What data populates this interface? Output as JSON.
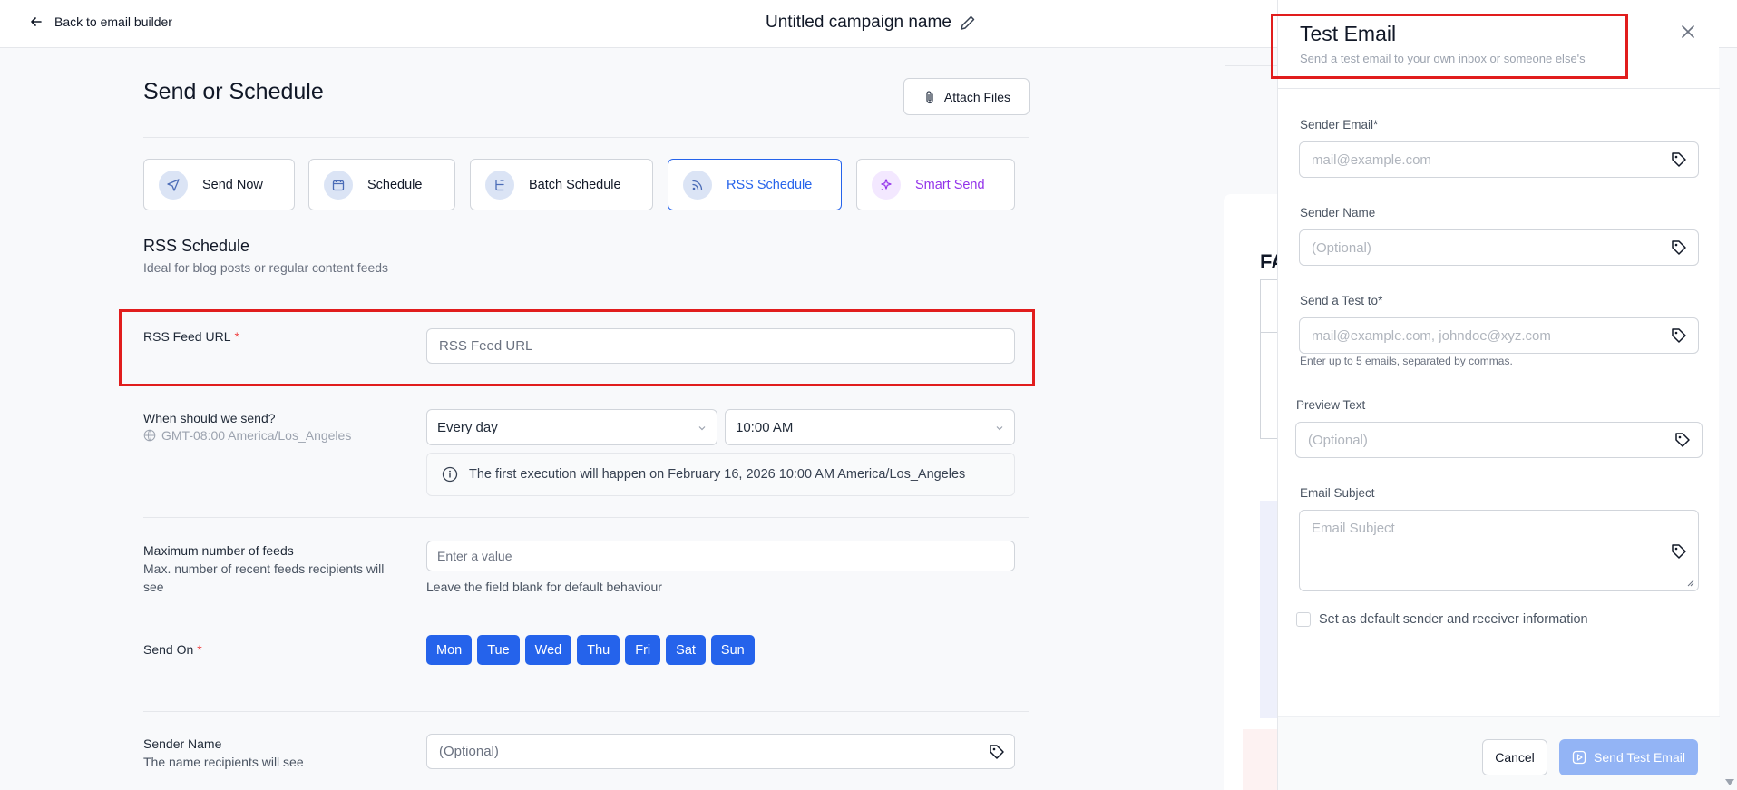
{
  "topbar": {
    "back_label": "Back to email builder",
    "campaign_name": "Untitled campaign name"
  },
  "main": {
    "title": "Send or Schedule",
    "attach_label": "Attach Files",
    "modes": [
      {
        "label": "Send Now",
        "icon": "send-icon"
      },
      {
        "label": "Schedule",
        "icon": "calendar-icon"
      },
      {
        "label": "Batch Schedule",
        "icon": "batch-icon"
      },
      {
        "label": "RSS Schedule",
        "icon": "rss-icon",
        "active": true
      },
      {
        "label": "Smart Send",
        "icon": "sparkle-icon"
      }
    ],
    "section_title": "RSS Schedule",
    "section_sub": "Ideal for blog posts or regular content feeds",
    "rss": {
      "label": "RSS Feed URL",
      "required": "*",
      "placeholder": "RSS Feed URL"
    },
    "when": {
      "label": "When should we send?",
      "timezone": "GMT-08:00 America/Los_Angeles",
      "frequency": "Every day",
      "time": "10:00 AM",
      "info": "The first execution will happen on February 16, 2026 10:00 AM America/Los_Angeles"
    },
    "max_feeds": {
      "label": "Maximum number of feeds",
      "sub": "Max. number of recent feeds recipients will see",
      "placeholder": "Enter a value",
      "hint": "Leave the field blank for default behaviour"
    },
    "send_on": {
      "label": "Send On",
      "required": "*",
      "days": [
        "Mon",
        "Tue",
        "Wed",
        "Thu",
        "Fri",
        "Sat",
        "Sun"
      ]
    },
    "sender_name": {
      "label": "Sender Name",
      "sub": "The name recipients will see",
      "placeholder": "(Optional)"
    }
  },
  "preview": {
    "heading_fragment": "FA"
  },
  "drawer": {
    "title": "Test Email",
    "subtitle": "Send a test email to your own inbox or someone else's",
    "fields": {
      "sender_email": {
        "label": "Sender Email*",
        "placeholder": "mail@example.com"
      },
      "sender_name": {
        "label": "Sender Name",
        "placeholder": "(Optional)"
      },
      "send_to": {
        "label": "Send a Test to*",
        "placeholder": "mail@example.com, johndoe@xyz.com",
        "hint": "Enter up to 5 emails, separated by commas."
      },
      "preview_text": {
        "label": "Preview Text",
        "placeholder": "(Optional)"
      },
      "subject": {
        "label": "Email Subject",
        "placeholder": "Email Subject"
      }
    },
    "default_checkbox": "Set as default sender and receiver information",
    "cancel_label": "Cancel",
    "send_label": "Send Test Email"
  },
  "colors": {
    "accent": "#2563eb",
    "highlight": "#e11d1d",
    "smart": "#9333ea"
  }
}
